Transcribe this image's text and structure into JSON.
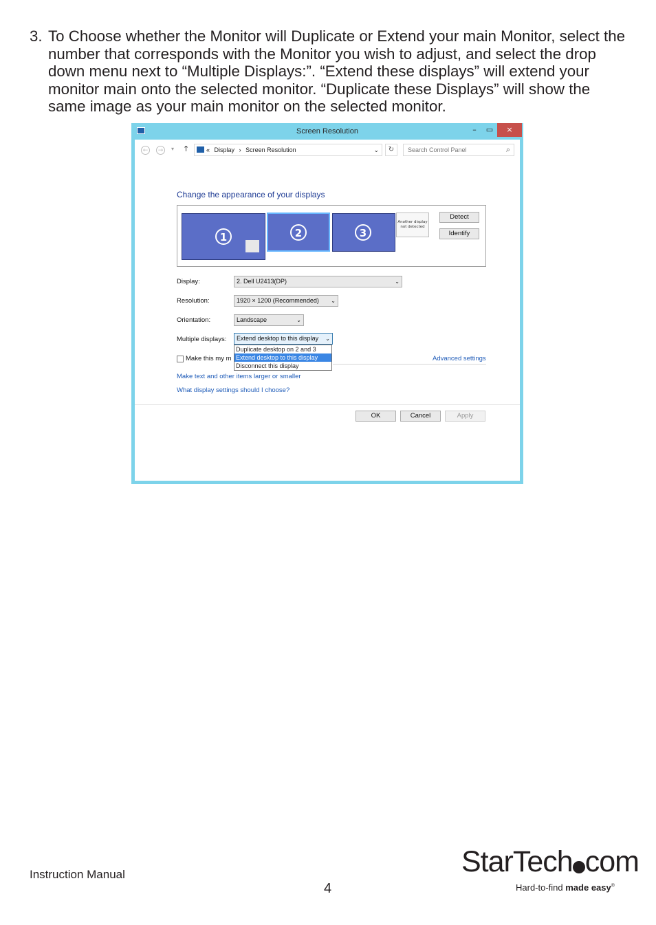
{
  "instruction": {
    "number": "3.",
    "text": "To Choose whether the Monitor will Duplicate or Extend your main Monitor, select the number that corresponds with the Monitor you wish to adjust, and select the drop down menu next to “Multiple Displays:”.  “Extend these displays” will extend your monitor main onto the selected monitor.  “Duplicate these Displays” will show the same image as your main monitor on the selected monitor."
  },
  "window": {
    "title": "Screen Resolution",
    "minimize": "–",
    "maximize": "▭",
    "close": "×",
    "nav": {
      "back": "←",
      "forward": "→",
      "dropdown": "▾",
      "up": "↑",
      "breadcrumb_prefix": "«",
      "breadcrumb_1": "Display",
      "breadcrumb_sep": "›",
      "breadcrumb_2": "Screen Resolution",
      "address_arrow": "⌄",
      "refresh": "↻",
      "search_placeholder": "Search Control Panel",
      "search_icon": "⌕"
    },
    "heading": "Change the appearance of your displays",
    "monitors": [
      "1",
      "2",
      "3"
    ],
    "another_display": "Another display not detected",
    "detect_button": "Detect",
    "identify_button": "Identify",
    "fields": {
      "display_label": "Display:",
      "display_value": "2. Dell U2413(DP)",
      "resolution_label": "Resolution:",
      "resolution_value": "1920 × 1200 (Recommended)",
      "orientation_label": "Orientation:",
      "orientation_value": "Landscape",
      "multiple_label": "Multiple displays:",
      "multiple_value": "Extend desktop to this display"
    },
    "dropdown_options": [
      "Duplicate desktop on 2 and 3",
      "Extend desktop to this display",
      "Disconnect this display"
    ],
    "make_main_label": "Make this my m",
    "advanced_settings": "Advanced settings",
    "link_text_size": "Make text and other items larger or smaller",
    "link_help": "What display settings should I choose?",
    "ok_button": "OK",
    "cancel_button": "Cancel",
    "apply_button": "Apply"
  },
  "footer": {
    "manual": "Instruction Manual",
    "page": "4",
    "logo_part1": "StarTech",
    "logo_part2": "com",
    "tagline_regular": "Hard-to-find ",
    "tagline_bold": "made easy",
    "tagline_mark": "®"
  },
  "colors": {
    "window_border": "#7dd3ea",
    "monitor_fill": "#5b6ec7",
    "link": "#1e5bb8",
    "highlight": "#3a86e4",
    "close_button": "#c7504b"
  }
}
